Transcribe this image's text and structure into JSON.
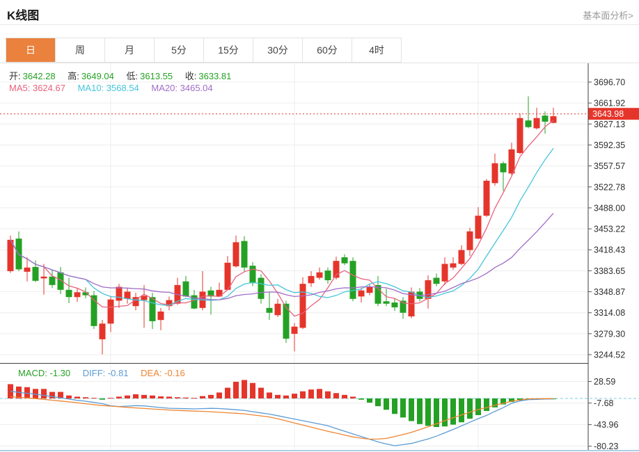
{
  "header": {
    "title": "K线图",
    "link": "基本面分析>"
  },
  "tabs": {
    "items": [
      "日",
      "周",
      "月",
      "5分",
      "15分",
      "30分",
      "60分",
      "4时"
    ],
    "active": "日"
  },
  "legend": {
    "ohlc": {
      "o_label": "开:",
      "o": "3642.28",
      "h_label": "高:",
      "h": "3649.04",
      "l_label": "低:",
      "l": "3613.55",
      "c_label": "收:",
      "c": "3633.81"
    },
    "ma": {
      "ma5_label": "MA5:",
      "ma5": "3624.67",
      "ma10_label": "MA10:",
      "ma10": "3568.54",
      "ma20_label": "MA20:",
      "ma20": "3465.04"
    },
    "macd": {
      "macd_label": "MACD:",
      "macd": "-1.30",
      "diff_label": "DIFF:",
      "diff": "-0.81",
      "dea_label": "DEA:",
      "dea": "-0.16"
    }
  },
  "colors": {
    "up": "#e5352b",
    "down": "#24a124",
    "ma5": "#e8617d",
    "ma10": "#45c5dc",
    "ma20": "#a16cc7",
    "diff": "#5b9bd5",
    "dea": "#ee8532",
    "tab_active": "#ea813c",
    "zero_line": "#79cfe2",
    "bottom_border": "#8fbde0"
  },
  "chart_data": {
    "type": "candlestick",
    "title": "K线图",
    "price_axis": {
      "max": 3696.7,
      "min": 3244.52,
      "current": 3643.98,
      "ticks": [
        3696.7,
        3661.92,
        3627.13,
        3592.35,
        3557.57,
        3522.78,
        3488.0,
        3453.22,
        3418.43,
        3383.65,
        3348.87,
        3314.08,
        3279.3,
        3244.52
      ]
    },
    "macd_axis": {
      "ticks": [
        28.59,
        -7.68,
        -43.96,
        -80.23
      ]
    },
    "ma_periods": [
      5,
      10,
      20
    ],
    "candles": [
      [
        3383,
        3442,
        3380,
        3435
      ],
      [
        3437,
        3449,
        3383,
        3386
      ],
      [
        3382,
        3406,
        3366,
        3389
      ],
      [
        3390,
        3401,
        3365,
        3367
      ],
      [
        3371,
        3395,
        3344,
        3374
      ],
      [
        3374,
        3386,
        3355,
        3360
      ],
      [
        3381,
        3390,
        3345,
        3352
      ],
      [
        3352,
        3372,
        3330,
        3340
      ],
      [
        3340,
        3355,
        3332,
        3348
      ],
      [
        3348,
        3356,
        3338,
        3343
      ],
      [
        3343,
        3350,
        3287,
        3292
      ],
      [
        3270,
        3302,
        3245,
        3296
      ],
      [
        3296,
        3342,
        3282,
        3336
      ],
      [
        3334,
        3362,
        3322,
        3357
      ],
      [
        3337,
        3355,
        3329,
        3349
      ],
      [
        3325,
        3347,
        3318,
        3340
      ],
      [
        3335,
        3360,
        3289,
        3342
      ],
      [
        3340,
        3347,
        3287,
        3300
      ],
      [
        3302,
        3322,
        3285,
        3316
      ],
      [
        3325,
        3341,
        3318,
        3335
      ],
      [
        3329,
        3372,
        3327,
        3360
      ],
      [
        3366,
        3375,
        3340,
        3341
      ],
      [
        3343,
        3352,
        3320,
        3321
      ],
      [
        3322,
        3383,
        3318,
        3349
      ],
      [
        3351,
        3357,
        3311,
        3341
      ],
      [
        3341,
        3364,
        3340,
        3352
      ],
      [
        3352,
        3408,
        3351,
        3397
      ],
      [
        3391,
        3442,
        3389,
        3431
      ],
      [
        3433,
        3441,
        3383,
        3389
      ],
      [
        3392,
        3398,
        3358,
        3363
      ],
      [
        3372,
        3378,
        3329,
        3337
      ],
      [
        3322,
        3349,
        3302,
        3314
      ],
      [
        3310,
        3337,
        3307,
        3329
      ],
      [
        3329,
        3334,
        3264,
        3271
      ],
      [
        3279,
        3297,
        3250,
        3291
      ],
      [
        3289,
        3373,
        3287,
        3362
      ],
      [
        3363,
        3383,
        3357,
        3375
      ],
      [
        3372,
        3389,
        3369,
        3381
      ],
      [
        3384,
        3389,
        3362,
        3368
      ],
      [
        3372,
        3407,
        3369,
        3400
      ],
      [
        3406,
        3411,
        3393,
        3396
      ],
      [
        3400,
        3406,
        3333,
        3337
      ],
      [
        3341,
        3355,
        3331,
        3351
      ],
      [
        3347,
        3361,
        3343,
        3357
      ],
      [
        3360,
        3375,
        3325,
        3329
      ],
      [
        3333,
        3354,
        3325,
        3329
      ],
      [
        3331,
        3338,
        3317,
        3323
      ],
      [
        3334,
        3340,
        3304,
        3314
      ],
      [
        3308,
        3356,
        3305,
        3349
      ],
      [
        3349,
        3355,
        3333,
        3337
      ],
      [
        3337,
        3376,
        3321,
        3368
      ],
      [
        3372,
        3379,
        3358,
        3362
      ],
      [
        3366,
        3406,
        3360,
        3395
      ],
      [
        3389,
        3406,
        3385,
        3396
      ],
      [
        3395,
        3426,
        3393,
        3418
      ],
      [
        3418,
        3455,
        3408,
        3449
      ],
      [
        3437,
        3489,
        3436,
        3475
      ],
      [
        3475,
        3536,
        3473,
        3533
      ],
      [
        3529,
        3578,
        3525,
        3562
      ],
      [
        3562,
        3565,
        3516,
        3547
      ],
      [
        3545,
        3596,
        3542,
        3585
      ],
      [
        3579,
        3645,
        3577,
        3637
      ],
      [
        3633,
        3673,
        3620,
        3622
      ],
      [
        3620,
        3654,
        3618,
        3637
      ],
      [
        3641,
        3648,
        3611,
        3631
      ],
      [
        3629,
        3654,
        3628,
        3640
      ]
    ],
    "macd": {
      "histogram": [
        24,
        20,
        19,
        16,
        16,
        11,
        11,
        5,
        3,
        2,
        1,
        -2,
        1,
        3,
        5,
        7,
        6,
        5,
        3.5,
        3,
        2,
        1.5,
        1,
        4,
        6,
        10,
        18,
        28,
        31,
        26,
        18,
        10,
        6,
        5,
        8,
        12,
        15,
        16,
        12,
        9,
        6,
        3,
        -2,
        -7,
        -13,
        -19,
        -26,
        -32,
        -38,
        -43,
        -46,
        -48,
        -47,
        -44,
        -40,
        -34,
        -28,
        -21,
        -15,
        -10,
        -6,
        -3.5,
        -2,
        -1.5,
        -1.4,
        -1.3
      ],
      "diff": [
        11.9,
        10.3,
        8.6,
        7.0,
        5.3,
        3.2,
        1.1,
        -1.1,
        -3.2,
        -4.7,
        -6.7,
        -8.8,
        -12.3,
        -13.5,
        -12.9,
        -12.0,
        -12.5,
        -13.9,
        -15.3,
        -16.5,
        -16.8,
        -17.2,
        -17.5,
        -17.1,
        -16.6,
        -16.9,
        -17.9,
        -18.9,
        -20.0,
        -22.2,
        -24.3,
        -26.3,
        -29.0,
        -31.8,
        -34.6,
        -37.4,
        -40.2,
        -43.0,
        -45.9,
        -50.5,
        -55.0,
        -59.6,
        -64.0,
        -68.4,
        -72.9,
        -76.5,
        -79.4,
        -77.6,
        -75.6,
        -71.8,
        -68.0,
        -63.3,
        -57.7,
        -52.1,
        -46.0,
        -39.9,
        -33.9,
        -28.5,
        -21.7,
        -15.4,
        -8.2,
        -4.2,
        -2.0,
        -1.5,
        -1.1,
        -0.81
      ],
      "dea": [
        2.9,
        1.9,
        0.8,
        -0.2,
        -1.5,
        -2.9,
        -4.3,
        -5.7,
        -7.2,
        -8.9,
        -10.4,
        -11.9,
        -12.8,
        -13.9,
        -15.0,
        -15.9,
        -16.8,
        -17.6,
        -18.6,
        -19.4,
        -20.1,
        -20.7,
        -21.3,
        -21.7,
        -22.3,
        -23.2,
        -24.1,
        -24.9,
        -25.8,
        -27.6,
        -29.3,
        -31.1,
        -34.2,
        -37.7,
        -41.2,
        -44.7,
        -48.2,
        -51.7,
        -55.1,
        -58.3,
        -61.4,
        -64.6,
        -66.7,
        -68.3,
        -68.2,
        -67.0,
        -64.0,
        -60.6,
        -57.0,
        -52.2,
        -47.5,
        -42.5,
        -37.4,
        -32.4,
        -27.7,
        -23.0,
        -18.7,
        -15.3,
        -11.3,
        -8.1,
        -4.7,
        -2.5,
        -0.8,
        -0.5,
        -0.3,
        -0.16
      ]
    }
  }
}
